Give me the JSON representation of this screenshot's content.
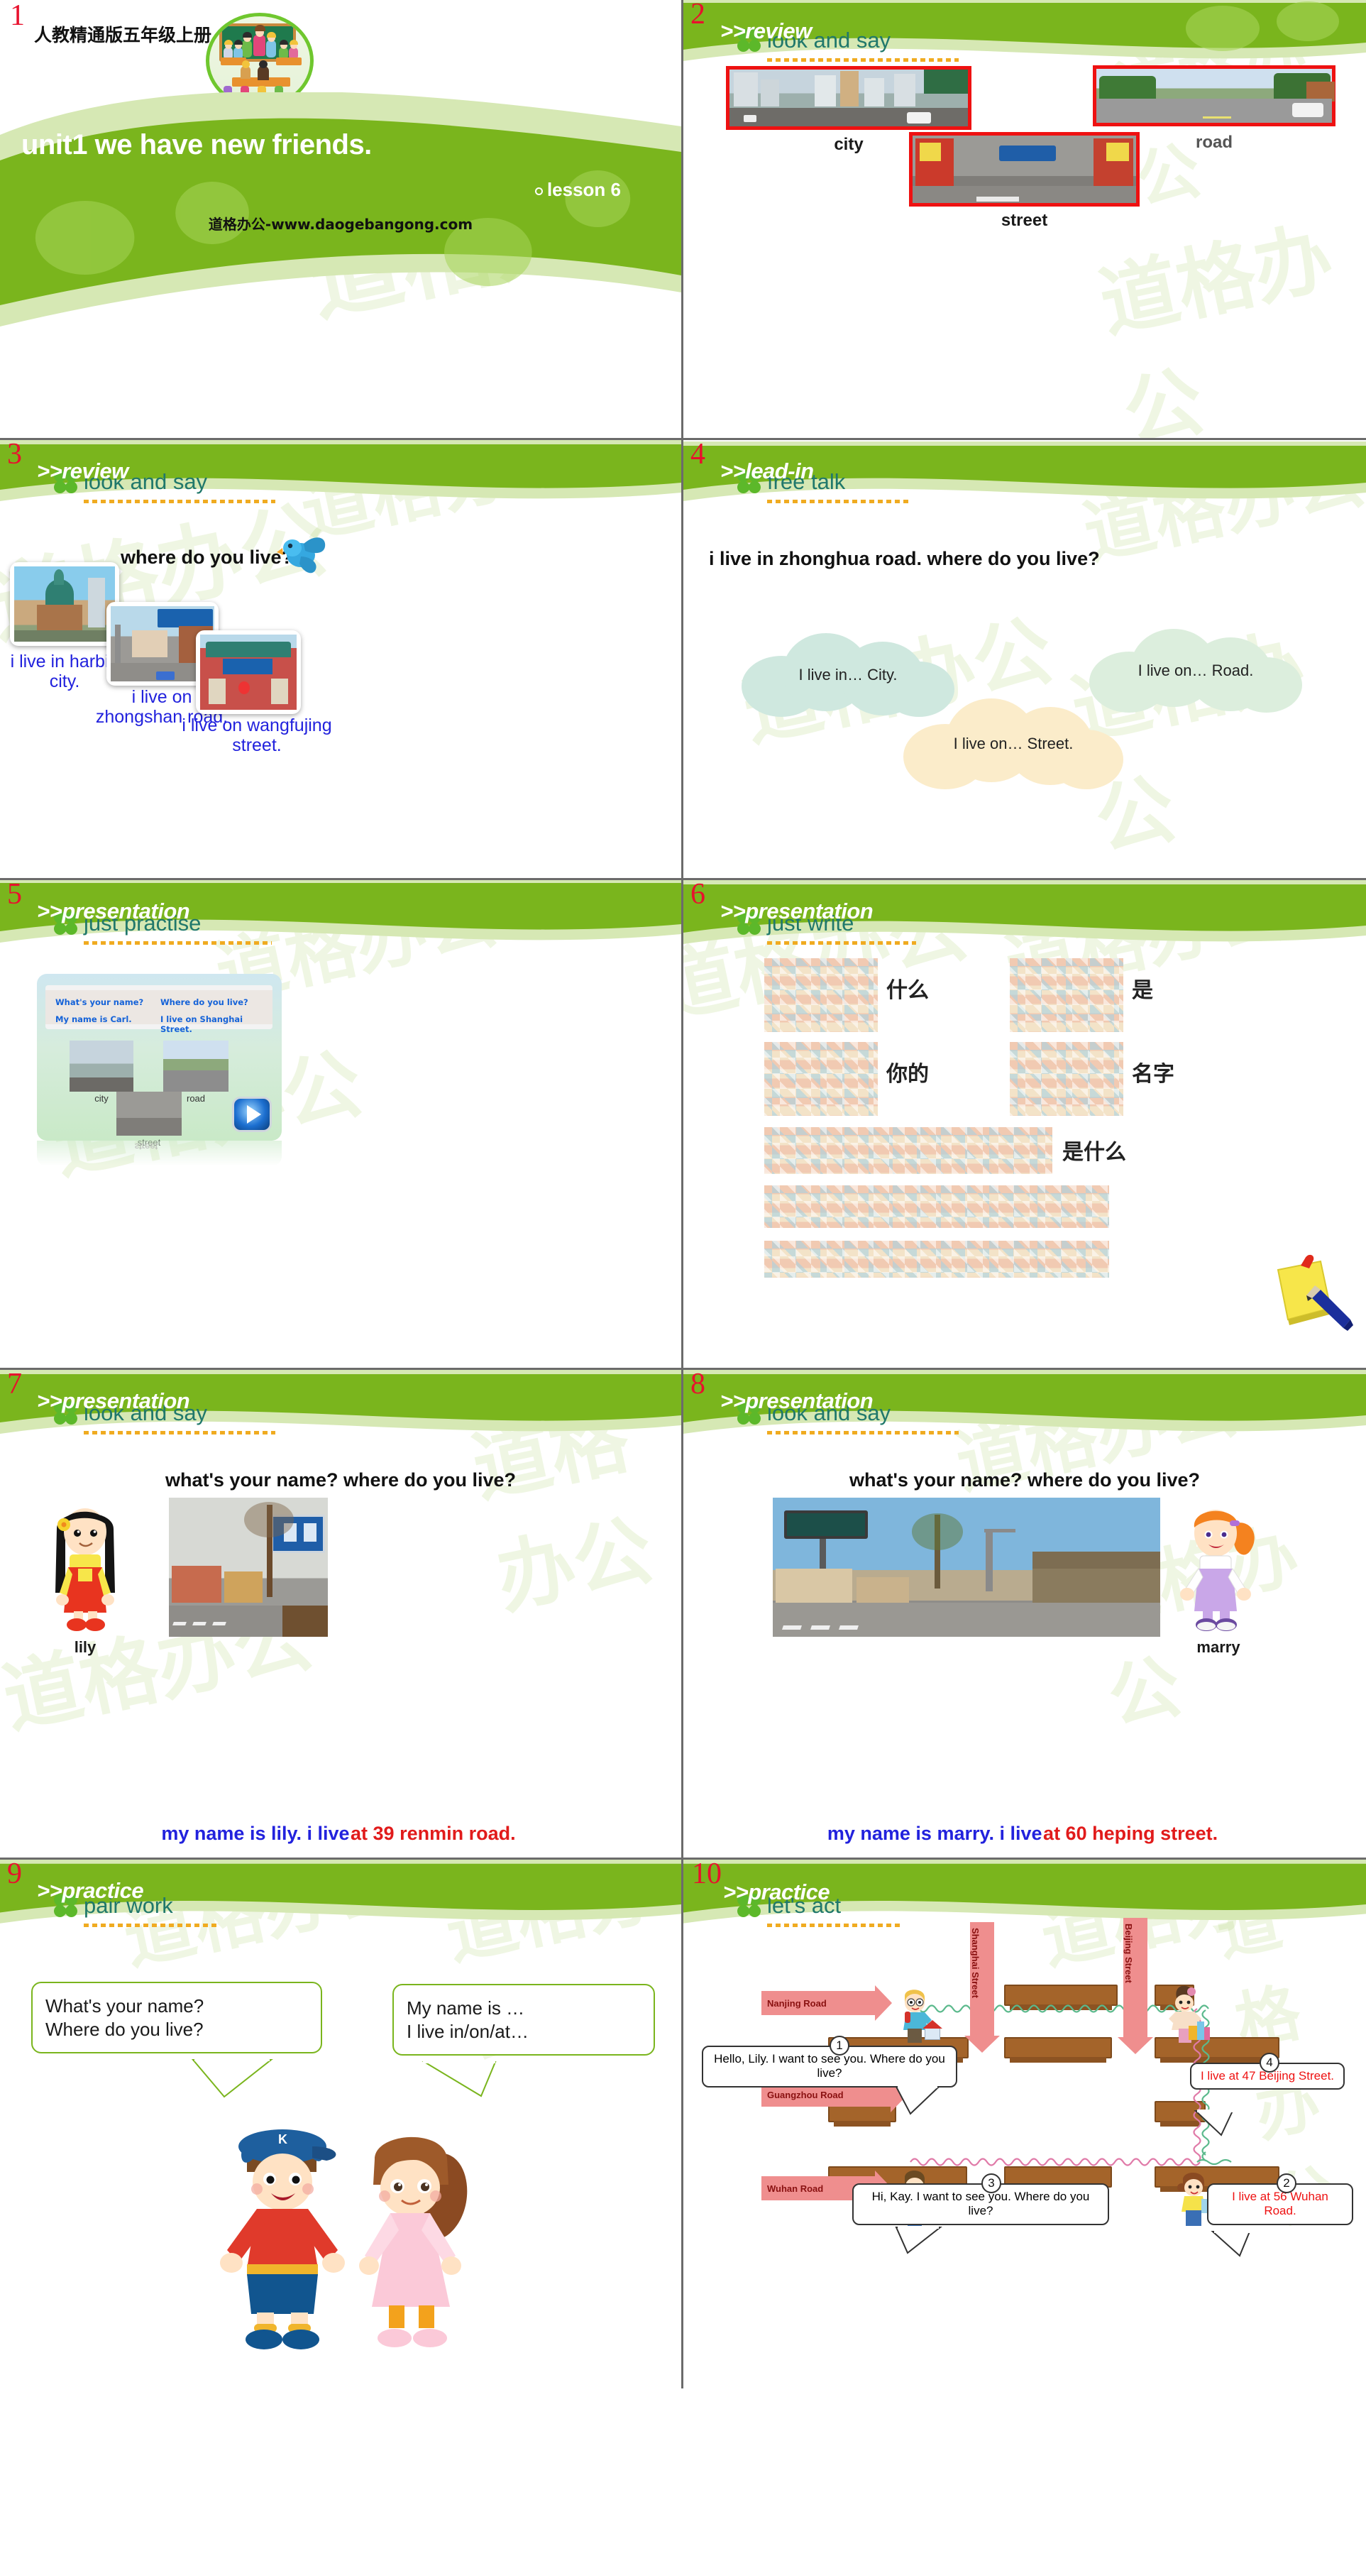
{
  "deck": {
    "watermark": "道格办公",
    "footer_url": "道格办公-www.daogebangong.com"
  },
  "slides": [
    {
      "number": "1",
      "subtitle": "人教精通版五年级上册",
      "title": "unit1 we have new friends.",
      "lesson": "lesson 6",
      "footer": "道格办公-www.daogebangong.com"
    },
    {
      "number": "2",
      "banner_label": ">>review",
      "section": "look and say",
      "items": [
        {
          "caption": "city"
        },
        {
          "caption": "road"
        },
        {
          "caption": "street"
        }
      ]
    },
    {
      "number": "3",
      "banner_label": ">>review",
      "section": "look and say",
      "question": "where do you live?",
      "cards": [
        {
          "caption": "i live in harbin city."
        },
        {
          "caption": "i live on zhongshan road."
        },
        {
          "caption": "i live on wangfujing street."
        }
      ]
    },
    {
      "number": "4",
      "banner_label": ">>lead-in",
      "section": "free talk",
      "prompt": "i live in zhonghua road. where do you live?",
      "clouds": [
        {
          "text": "I live in… City.",
          "color": "#cfe8df"
        },
        {
          "text": "I live on… Road.",
          "color": "#dceedd"
        },
        {
          "text": "I live on… Street.",
          "color": "#fbecca"
        }
      ]
    },
    {
      "number": "5",
      "banner_label": ">>presentation",
      "section": "just practise",
      "scroll": {
        "q1": "What's your name?",
        "a1": "My name is Carl.",
        "q2": "Where do you live?",
        "a2": "I live on Shanghai Street."
      },
      "items": [
        {
          "caption": "city"
        },
        {
          "caption": "road"
        },
        {
          "caption": "street"
        }
      ],
      "play_button": "play-icon"
    },
    {
      "number": "6",
      "banner_label": ">>presentation",
      "section": "just write",
      "words": [
        {
          "text": "什么"
        },
        {
          "text": "是"
        },
        {
          "text": "你的"
        },
        {
          "text": "名字"
        },
        {
          "text": "是什么"
        }
      ]
    },
    {
      "number": "7",
      "banner_label": ">>presentation",
      "section": "look and say",
      "question": "what's your name? where do you live?",
      "name_label": "lily",
      "answer_blue": "my name is lily. i live ",
      "answer_red": "at 39 renmin road.",
      "answer_full": "my name is lily. i live at 39 renmin road."
    },
    {
      "number": "8",
      "banner_label": ">>presentation",
      "section": "look and say",
      "question": "what's your name? where do you live?",
      "name_label": "marry",
      "answer_blue": "my name is marry. i live ",
      "answer_red": "at 60 heping street.",
      "answer_full": "my name is marry. i live at 60 heping street."
    },
    {
      "number": "9",
      "banner_label": ">>practice",
      "section": "pair work",
      "bubble_left_line1": "What's your name?",
      "bubble_left_line2": "Where do you live?",
      "bubble_right_line1": "My name is …",
      "bubble_right_line2": "I live in/on/at…"
    },
    {
      "number": "10",
      "banner_label": ">>practice",
      "section": "let's act",
      "roads": [
        {
          "label": "Nanjing Road"
        },
        {
          "label": "Guangzhou Road"
        },
        {
          "label": "Wuhan Road"
        }
      ],
      "streets": [
        {
          "label": "Shanghai Street"
        },
        {
          "label": "Beijing Street"
        }
      ],
      "bubbles": [
        {
          "num": "1",
          "text": "Hello, Lily. I want to see you. Where do you live?",
          "color": "black"
        },
        {
          "num": "4",
          "text": "I live at 47 Beijing Street.",
          "color": "red"
        },
        {
          "num": "3",
          "text": "Hi, Kay. I want to see you. Where do you live?",
          "color": "black"
        },
        {
          "num": "2",
          "text": "I live at 56 Wuhan Road.",
          "color": "red"
        }
      ]
    }
  ],
  "colors": {
    "banner_green": "#7ab51d",
    "banner_green_light": "#d6e8b4",
    "accent_red": "#e8112d",
    "section_teal": "#20786b",
    "dot_orange": "#f0ab21",
    "blue_text": "#2222dd",
    "red_text": "#e11b1b"
  }
}
